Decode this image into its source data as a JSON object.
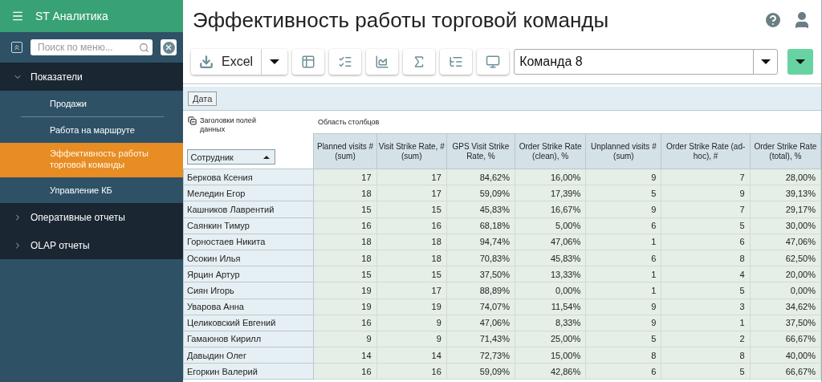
{
  "app_title": "ST Аналитика",
  "menu_search": {
    "placeholder": "Поиск по меню..."
  },
  "menu": [
    {
      "label": "Показатели",
      "expanded": true,
      "children": [
        {
          "label": "Продажи",
          "selected": false
        },
        {
          "label": "Работа на маршруте",
          "selected": false
        },
        {
          "label": "Эффективность работы торговой команды",
          "selected": true
        },
        {
          "label": "Управление КБ",
          "selected": false
        }
      ]
    },
    {
      "label": "Оперативные отчеты",
      "expanded": false
    },
    {
      "label": "OLAP отчеты",
      "expanded": false
    }
  ],
  "page_title": "Эффективность работы торговой команды",
  "toolbar": {
    "export_label": "Excel",
    "team_select": {
      "value": "Команда 8"
    }
  },
  "filter_fields": [
    "Дата"
  ],
  "pivot": {
    "data_fields_label": "Заголовки полей данных",
    "column_area_label": "Область столбцов",
    "row_field": {
      "label": "Сотрудник",
      "sorted_ascending": true
    },
    "columns": [
      "Planned visits # (sum)",
      "Visit Strike Rate, # (sum)",
      "GPS Visit Strike Rate, %",
      "Order Strike Rate (clean), %",
      "Unplanned visits # (sum)",
      "Order Strike Rate (ad-hoc), #",
      "Order Strike Rate (total), %"
    ],
    "rows": [
      {
        "name": "Беркова Ксения",
        "values": [
          "17",
          "17",
          "84,62%",
          "16,00%",
          "9",
          "7",
          "28,00%"
        ]
      },
      {
        "name": "Меледин Егор",
        "values": [
          "18",
          "17",
          "59,09%",
          "17,39%",
          "5",
          "9",
          "39,13%"
        ]
      },
      {
        "name": "Кашников Лаврентий",
        "values": [
          "15",
          "15",
          "45,83%",
          "16,67%",
          "9",
          "7",
          "29,17%"
        ]
      },
      {
        "name": "Саянкин Тимур",
        "values": [
          "16",
          "16",
          "68,18%",
          "5,00%",
          "6",
          "5",
          "30,00%"
        ]
      },
      {
        "name": "Горностаев Никита",
        "values": [
          "18",
          "18",
          "94,74%",
          "47,06%",
          "1",
          "6",
          "47,06%"
        ]
      },
      {
        "name": "Осокин Илья",
        "values": [
          "18",
          "18",
          "70,83%",
          "45,83%",
          "6",
          "8",
          "62,50%"
        ]
      },
      {
        "name": "Ярцин Артур",
        "values": [
          "15",
          "15",
          "37,50%",
          "13,33%",
          "1",
          "4",
          "20,00%"
        ]
      },
      {
        "name": "Сиян Игорь",
        "values": [
          "19",
          "17",
          "88,89%",
          "0,00%",
          "1",
          "5",
          "0,00%"
        ]
      },
      {
        "name": "Уварова Анна",
        "values": [
          "19",
          "19",
          "74,07%",
          "11,54%",
          "9",
          "3",
          "34,62%"
        ]
      },
      {
        "name": "Целиковский Евгений",
        "values": [
          "16",
          "9",
          "47,06%",
          "8,33%",
          "9",
          "1",
          "37,50%"
        ]
      },
      {
        "name": "Гамаюнов Кирилл",
        "values": [
          "9",
          "9",
          "71,43%",
          "25,00%",
          "5",
          "2",
          "66,67%"
        ]
      },
      {
        "name": "Давыдин Олег",
        "values": [
          "14",
          "14",
          "72,73%",
          "15,00%",
          "8",
          "8",
          "40,00%"
        ]
      },
      {
        "name": "Егоркин Валерий",
        "values": [
          "16",
          "16",
          "59,09%",
          "42,86%",
          "6",
          "5",
          "66,67%"
        ]
      }
    ]
  }
}
